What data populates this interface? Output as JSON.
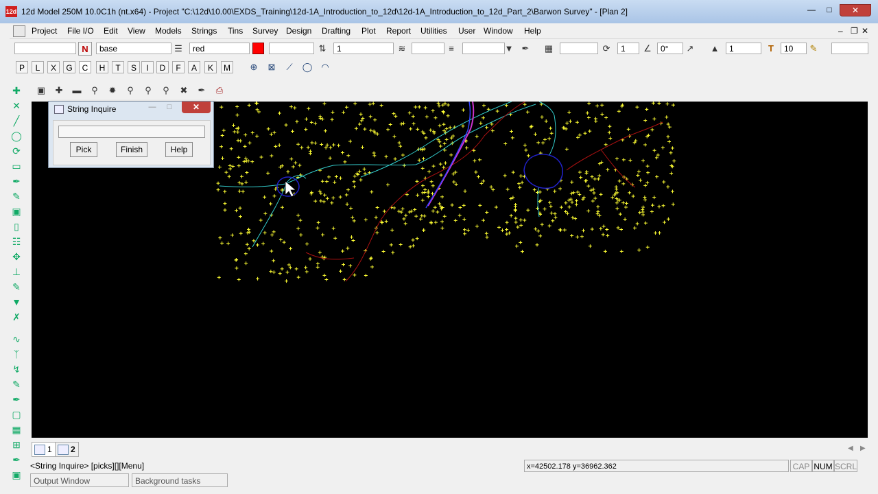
{
  "window": {
    "title": "12d Model 250M 10.0C1h (nt.x64) - Project \"C:\\12d\\10.00\\EXDS_Training\\12d-1A_Introduction_to_12d\\12d-1A_Introduction_to_12d_Part_2\\Barwon Survey\" - [Plan 2]",
    "icon_text": "12d"
  },
  "menu": [
    "Project",
    "File I/O",
    "Edit",
    "View",
    "Models",
    "Strings",
    "Tins",
    "Survey",
    "Design",
    "Drafting",
    "Plot",
    "Report",
    "Utilities",
    "User",
    "Window",
    "Help"
  ],
  "toolbar": {
    "name_value": "",
    "model_value": "base",
    "colour_value": "red",
    "colour_hex": "#ff0000",
    "field_empty": "",
    "count_value": "1",
    "weight_value": "1",
    "angle_value": "0°",
    "text_count": "1",
    "text_size": "10"
  },
  "snap_buttons": [
    "P",
    "L",
    "X",
    "G",
    "C",
    "H",
    "T",
    "S",
    "I",
    "D",
    "F",
    "A",
    "K",
    "M"
  ],
  "dialog": {
    "title": "String Inquire",
    "input_value": "",
    "buttons": [
      "Pick",
      "Finish",
      "Help"
    ]
  },
  "tabs": [
    "1",
    "2"
  ],
  "status": {
    "prompt": "<String Inquire> [picks][][Menu]",
    "coords": "x=42502.178 y=36962.362",
    "indicators": [
      "CAP",
      "NUM",
      "SCRL"
    ],
    "output_window": "Output Window",
    "background_tasks": "Background tasks"
  },
  "colors": {
    "survey_points": "#ffff33",
    "string_cyan": "#33cccc",
    "string_red": "#aa1111",
    "string_blue": "#2222cc",
    "string_magenta": "#cc33cc"
  }
}
